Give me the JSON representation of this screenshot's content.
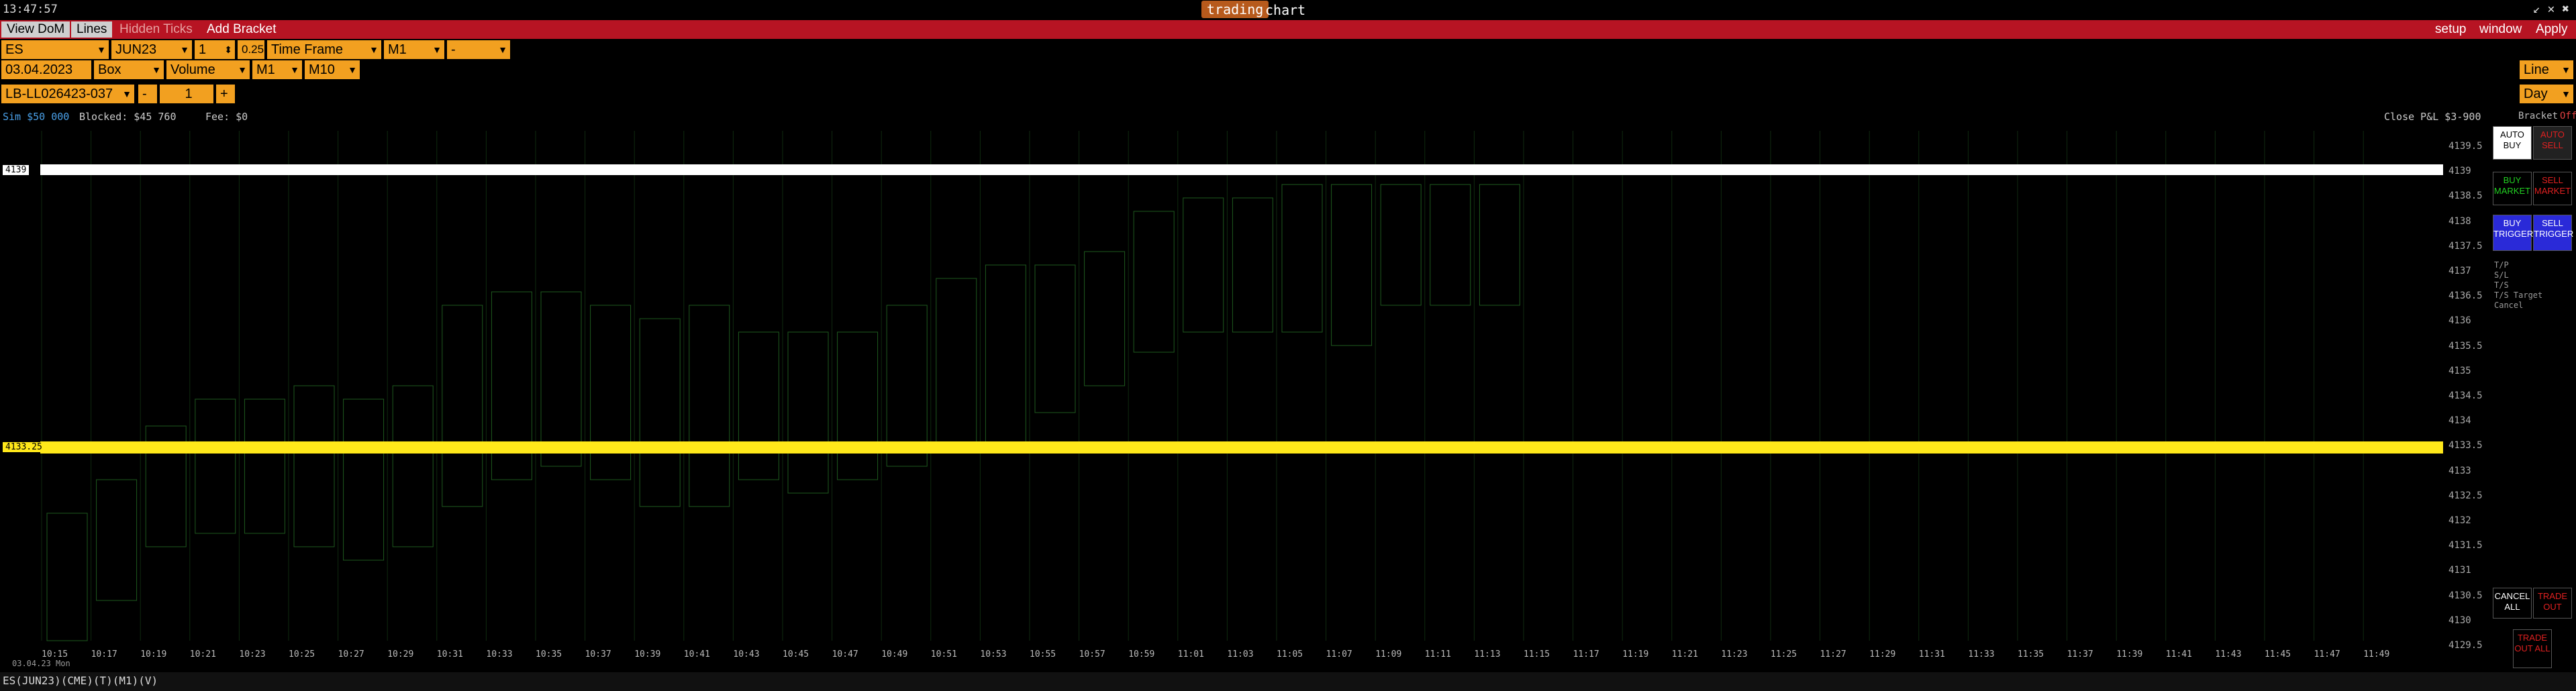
{
  "titlebar": {
    "clock": "13:47:57",
    "title_badge": "trading",
    "title_rest": "chart",
    "controls": "↙ ✕ ✖"
  },
  "menubar": {
    "view_dom": "View DoM",
    "lines": "Lines",
    "hidden_ticks": "Hidden Ticks",
    "add_bracket": "Add Bracket",
    "setup": "setup",
    "window": "window",
    "apply": "Apply"
  },
  "controls": {
    "symbol": "ES",
    "contract": "JUN23",
    "qty": "1",
    "tick": "0.25",
    "frame_type": "Time Frame",
    "frame_val": "M1",
    "frame_extra": "-",
    "date": "03.04.2023",
    "box": "Box",
    "volume": "Volume",
    "m1": "M1",
    "m10": "M10",
    "account": "LB-LL026423-037",
    "minus": "-",
    "order_qty": "1",
    "plus": "+",
    "line": "Line",
    "day": "Day"
  },
  "infobar": {
    "sim": "Sim $50 000",
    "blocked": "Blocked: $45 760",
    "fee": "Fee: $0",
    "close_pnl": "Close P&L $3-900",
    "bracket": "Bracket",
    "bracket_state": "Off"
  },
  "price_labels": [
    "4139.5",
    "4139",
    "4138.5",
    "4138",
    "4137.5",
    "4137",
    "4136.5",
    "4136",
    "4135.5",
    "4135",
    "4134.5",
    "4134",
    "4133.5",
    "4133",
    "4132.5",
    "4132",
    "4131.5",
    "4131",
    "4130.5",
    "4130",
    "4129.5"
  ],
  "time_labels": [
    "10:15",
    "10:17",
    "10:19",
    "10:21",
    "10:23",
    "10:25",
    "10:27",
    "10:29",
    "10:31",
    "10:33",
    "10:35",
    "10:37",
    "10:39",
    "10:41",
    "10:43",
    "10:45",
    "10:47",
    "10:49",
    "10:51",
    "10:53",
    "10:55",
    "10:57",
    "10:59",
    "11:01",
    "11:03",
    "11:05",
    "11:07",
    "11:09",
    "11:11",
    "11:13",
    "11:15",
    "11:17",
    "11:19",
    "11:21",
    "11:23",
    "11:25",
    "11:27",
    "11:29",
    "11:31",
    "11:33",
    "11:35",
    "11:37",
    "11:39",
    "11:41",
    "11:43",
    "11:45",
    "11:47",
    "11:49"
  ],
  "date_label": "03.04.23 Mon",
  "highlight_price": "4133.25",
  "white_price": "4139",
  "right_panel": {
    "auto_buy": "AUTO BUY",
    "auto_sell": "AUTO SELL",
    "buy_market": "BUY MARKET",
    "sell_market": "SELL MARKET",
    "buy_trigger": "BUY TRIGGER",
    "sell_trigger": "SELL TRIGGER",
    "tp": "T/P",
    "sl": "S/L",
    "ts": "T/S",
    "ts_target": "T/S Target",
    "cancel": "Cancel",
    "cancel_all": "CANCEL ALL",
    "trade_out": "TRADE OUT",
    "trade_out_all": "TRADE OUT ALL"
  },
  "status": "ES(JUN23)(CME)(T)(M1)(V)",
  "colors": {
    "accent_orange": "#f2a020",
    "menu_red": "#b71423",
    "highlight_yellow": "#ffe81a",
    "cell_green": "#8cd28c",
    "cell_red": "#d81818"
  }
}
